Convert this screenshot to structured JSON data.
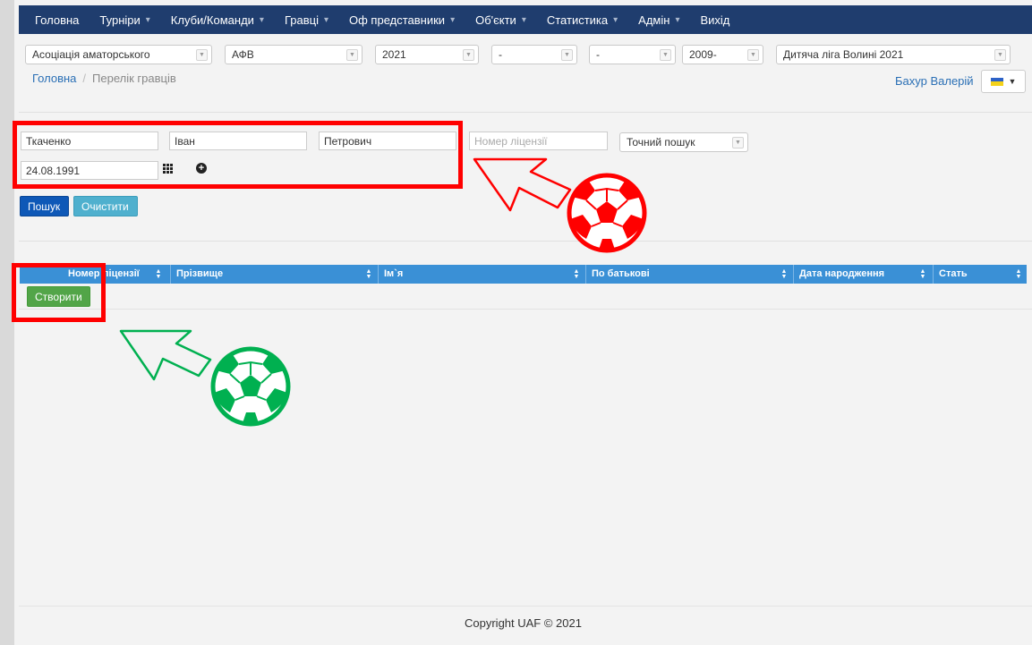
{
  "nav": {
    "items": [
      {
        "label": "Головна",
        "dropdown": false
      },
      {
        "label": "Турніри",
        "dropdown": true
      },
      {
        "label": "Клуби/Команди",
        "dropdown": true
      },
      {
        "label": "Гравці",
        "dropdown": true
      },
      {
        "label": "Оф представники",
        "dropdown": true
      },
      {
        "label": "Об'єкти",
        "dropdown": true
      },
      {
        "label": "Статистика",
        "dropdown": true
      },
      {
        "label": "Адмін",
        "dropdown": true
      },
      {
        "label": "Вихід",
        "dropdown": false
      }
    ],
    "bg_color": "#1f3d6e"
  },
  "filters": {
    "association": "Асоціація аматорського",
    "federation": "АФВ",
    "year": "2021",
    "filter4": "-",
    "filter5": "-",
    "birth_year": "2009-",
    "league": "Дитяча ліга Волині 2021"
  },
  "breadcrumb": {
    "home": "Головна",
    "separator": "/",
    "current": "Перелік гравців"
  },
  "user": {
    "name": "Бахур Валерій",
    "language_flag": "ua-flag-icon"
  },
  "search": {
    "last_name": "Ткаченко",
    "first_name": "Іван",
    "patronymic": "Петрович",
    "license_placeholder": "Номер ліцензії",
    "search_mode": "Точний пошук",
    "birth_date": "24.08.1991",
    "search_button": "Пошук",
    "clear_button": "Очистити"
  },
  "table": {
    "columns": [
      "Номер ліцензії",
      "Прізвище",
      "Ім`я",
      "По батькові",
      "Дата народження",
      "Стать"
    ],
    "header_color": "#3a90d6"
  },
  "actions": {
    "create_button": "Створити"
  },
  "footer": {
    "copyright": "Copyright UAF © 2021"
  },
  "colors": {
    "annotation_red": "#ff0000",
    "annotation_green": "#00b050",
    "link_blue": "#2a6fb5"
  }
}
